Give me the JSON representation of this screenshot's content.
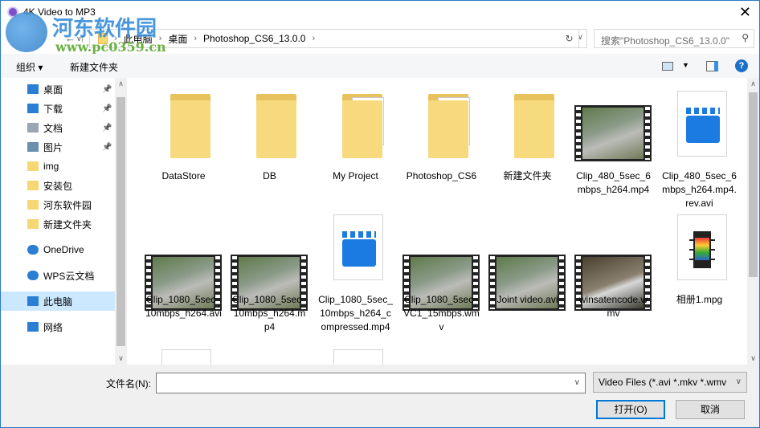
{
  "title": "4K Video to MP3",
  "watermark": {
    "name": "河东软件园",
    "url": "www.pc0359.cn"
  },
  "address": {
    "crumbs": [
      "此电脑",
      "桌面",
      "Photoshop_CS6_13.0.0"
    ],
    "search_placeholder": "搜索\"Photoshop_CS6_13.0.0\""
  },
  "toolbar": {
    "organize": "组织 ▾",
    "new_folder": "新建文件夹"
  },
  "sidebar": [
    {
      "label": "桌面",
      "icon": "desktop",
      "pinned": true
    },
    {
      "label": "下载",
      "icon": "download",
      "pinned": true
    },
    {
      "label": "文档",
      "icon": "document",
      "pinned": true
    },
    {
      "label": "图片",
      "icon": "picture",
      "pinned": true
    },
    {
      "label": "img",
      "icon": "folder"
    },
    {
      "label": "安装包",
      "icon": "folder"
    },
    {
      "label": "河东软件园",
      "icon": "folder"
    },
    {
      "label": "新建文件夹",
      "icon": "folder"
    },
    {
      "label": "OneDrive",
      "icon": "cloud"
    },
    {
      "label": "WPS云文档",
      "icon": "cloud"
    },
    {
      "label": "此电脑",
      "icon": "computer",
      "selected": true
    },
    {
      "label": "网络",
      "icon": "network"
    }
  ],
  "files": [
    {
      "name": "DataStore",
      "type": "folder"
    },
    {
      "name": "DB",
      "type": "folder"
    },
    {
      "name": "My Project",
      "type": "folder-doc"
    },
    {
      "name": "Photoshop_CS6",
      "type": "folder-pdf"
    },
    {
      "name": "新建文件夹",
      "type": "folder"
    },
    {
      "name": "Clip_480_5sec_6mbps_h264.mp4",
      "type": "video"
    },
    {
      "name": "Clip_480_5sec_6mbps_h264.mp4.rev.avi",
      "type": "clapper"
    },
    {
      "name": "Clip_1080_5sec_10mbps_h264.avi",
      "type": "video"
    },
    {
      "name": "Clip_1080_5sec_10mbps_h264.mp4",
      "type": "video"
    },
    {
      "name": "Clip_1080_5sec_10mbps_h264_compressed.mp4",
      "type": "clapper"
    },
    {
      "name": "Clip_1080_5sec_VC1_15mbps.wmv",
      "type": "video"
    },
    {
      "name": "Joint video.avi",
      "type": "video"
    },
    {
      "name": "winsatencode.wmv",
      "type": "video-water"
    },
    {
      "name": "相册1.mpg",
      "type": "mpg"
    }
  ],
  "bottom": {
    "filename_label": "文件名(N):",
    "filename_value": "",
    "filetype": "Video Files (*.avi *.mkv *.wmv",
    "open": "打开(O)",
    "cancel": "取消"
  }
}
